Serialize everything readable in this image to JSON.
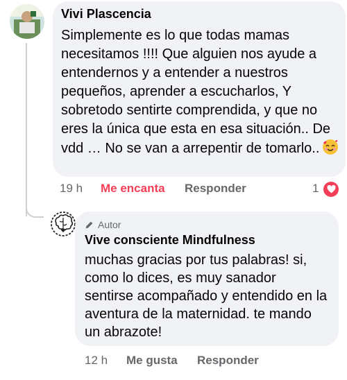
{
  "comment1": {
    "author": "Vivi Plascencia",
    "text": "Simplemente es lo que todas mamas necesitamos !!!! Que alguien nos ayude a entendernos y a entender a nuestros pequeños, aprender a escucharlos, Y sobretodo sentirte comprendida, y que no eres la única  que esta en esa situación..  De vdd … No se van a arrepentir de tomarlo..",
    "emoji": "smiling-face-with-hearts",
    "time": "19 h",
    "reaction_label": "Me encanta",
    "reply_label": "Responder",
    "reaction_count": "1",
    "reaction_color": "#f33e58"
  },
  "comment2": {
    "badge": "Autor",
    "author": "Vive consciente Mindfulness",
    "text": "muchas gracias por tus palabras! si, como lo dices, es muy sanador sentirse acompañado y entendido en la aventura de la maternidad. te mando un abrazote!",
    "time": "12 h",
    "like_label": "Me gusta",
    "reply_label": "Responder"
  }
}
